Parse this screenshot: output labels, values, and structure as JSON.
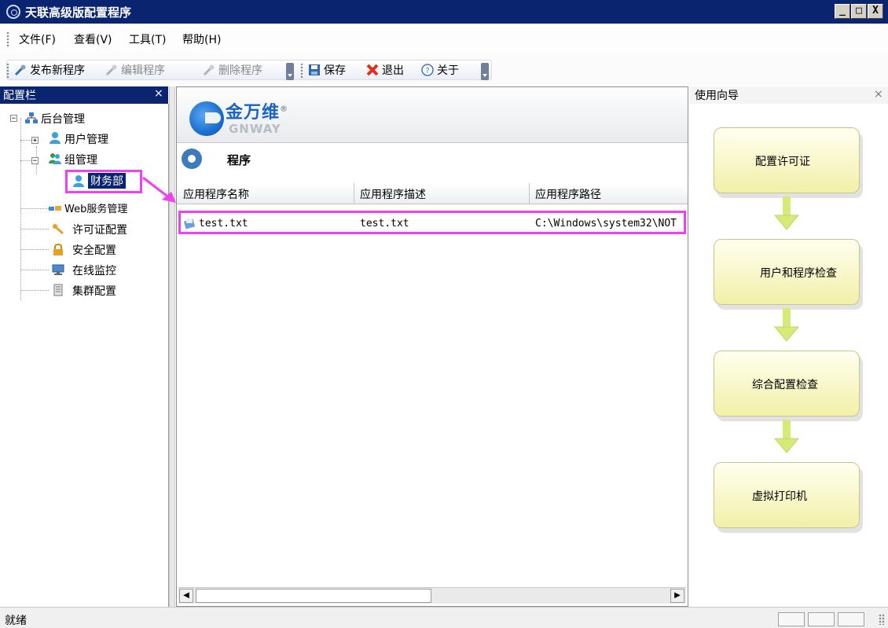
{
  "window": {
    "title": "天联高级版配置程序",
    "buttons": [
      "_",
      "□",
      "X"
    ]
  },
  "menu": [
    "文件(F)",
    "查看(V)",
    "工具(T)",
    "帮助(H)"
  ],
  "toolbar": {
    "publish": "发布新程序",
    "edit": "编辑程序",
    "delete": "删除程序",
    "save": "保存",
    "exit": "退出",
    "about": "关于"
  },
  "config_panel": {
    "title": "配置栏",
    "close": "×",
    "tree": {
      "root": "后台管理",
      "user_mgmt": "用户管理",
      "group_mgmt": "组管理",
      "finance": "财务部",
      "web_service": "Web服务管理",
      "license": "许可证配置",
      "security": "安全配置",
      "monitor": "在线监控",
      "cluster": "集群配置"
    }
  },
  "main": {
    "logo_cn": "金万维",
    "logo_en": "GNWAY",
    "section_title": "程序",
    "columns": [
      "应用程序名称",
      "应用程序描述",
      "应用程序路径"
    ],
    "rows": [
      {
        "name": "test.txt",
        "desc": "test.txt",
        "path": "C:\\Windows\\system32\\NOT"
      }
    ]
  },
  "guide": {
    "title": "使用向导",
    "close": "×",
    "steps": [
      "配置许可证",
      "用户和程序检查",
      "综合配置检查",
      "虚拟打印机"
    ]
  },
  "status": {
    "text": "就绪"
  },
  "colors": {
    "titlebar": "#0b2470",
    "highlight": "#f040f0",
    "accent": "#1a63c4"
  }
}
